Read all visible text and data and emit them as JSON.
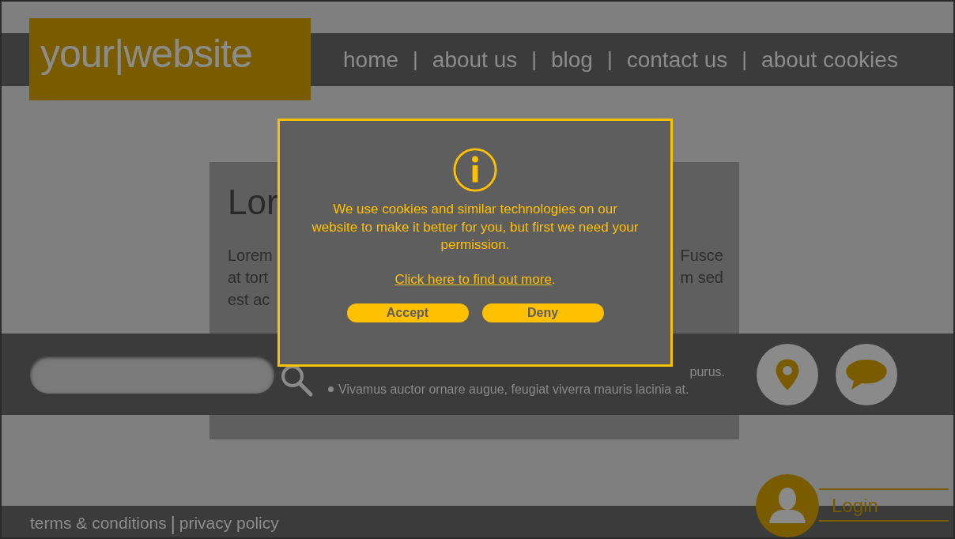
{
  "logo": {
    "text": "your|website"
  },
  "nav": [
    {
      "kind": "link",
      "text": "home"
    },
    {
      "kind": "separator",
      "text": "|"
    },
    {
      "kind": "link",
      "text": "about us"
    },
    {
      "kind": "separator",
      "text": "|"
    },
    {
      "kind": "link",
      "text": "blog"
    },
    {
      "kind": "separator",
      "text": "|"
    },
    {
      "kind": "link",
      "text": "contact us"
    },
    {
      "kind": "separator",
      "text": "|"
    },
    {
      "kind": "link",
      "text": "about cookies"
    }
  ],
  "article": {
    "heading": "Lor",
    "lines_left": [
      "Lorem",
      "at tort",
      "est ac"
    ],
    "lines_right": [
      "Fusce",
      "m sed"
    ]
  },
  "bullet_tail": "purus.",
  "bullets": [
    "Vivamus auctor ornare augue, feugiat viverra mauris lacinia at."
  ],
  "footer": [
    {
      "kind": "link",
      "text": "terms & conditions"
    },
    {
      "kind": "separator",
      "text": "|"
    },
    {
      "kind": "link",
      "text": "privacy policy"
    }
  ],
  "login": {
    "label": "Login"
  },
  "dialog": {
    "message": "We use cookies and similar technologies on our website to make it better for you, but first we need your permission.",
    "link": "Click here to find out more",
    "link_after": ".",
    "buttons": [
      "Accept",
      "Deny"
    ]
  }
}
